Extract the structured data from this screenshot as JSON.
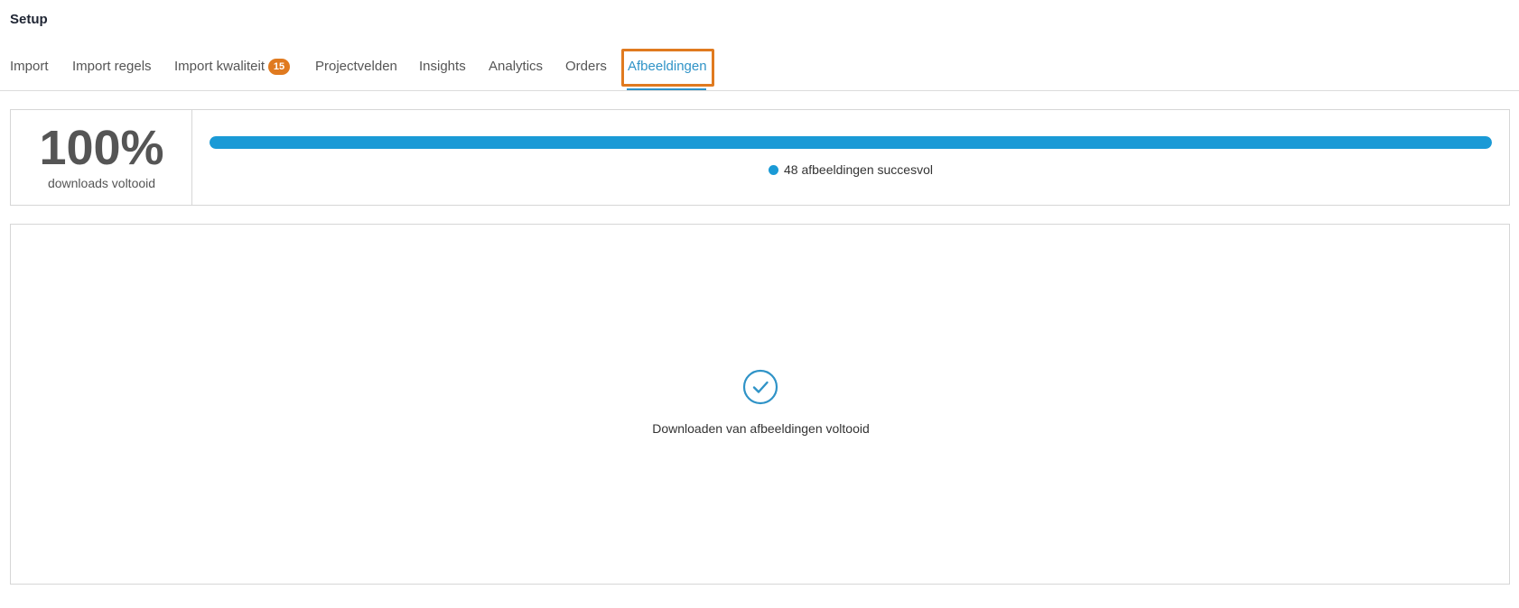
{
  "header": {
    "title": "Setup"
  },
  "tabs": [
    {
      "label": "Import"
    },
    {
      "label": "Import regels"
    },
    {
      "label": "Import kwaliteit",
      "badge": "15"
    },
    {
      "label": "Projectvelden"
    },
    {
      "label": "Insights"
    },
    {
      "label": "Analytics"
    },
    {
      "label": "Orders"
    },
    {
      "label": "Afbeeldingen",
      "active": true
    }
  ],
  "stats": {
    "percent_text": "100%",
    "percent_label": "downloads voltooid",
    "progress": 1.0,
    "legend_text": "48 afbeeldingen succesvol"
  },
  "main": {
    "icon": "check-circle-icon",
    "status_text": "Downloaden van afbeeldingen voltooid"
  },
  "colors": {
    "accent": "#1a9ad6",
    "active_tab": "#2f93c7",
    "badge": "#e07a1f",
    "highlight": "#e07a1f"
  }
}
